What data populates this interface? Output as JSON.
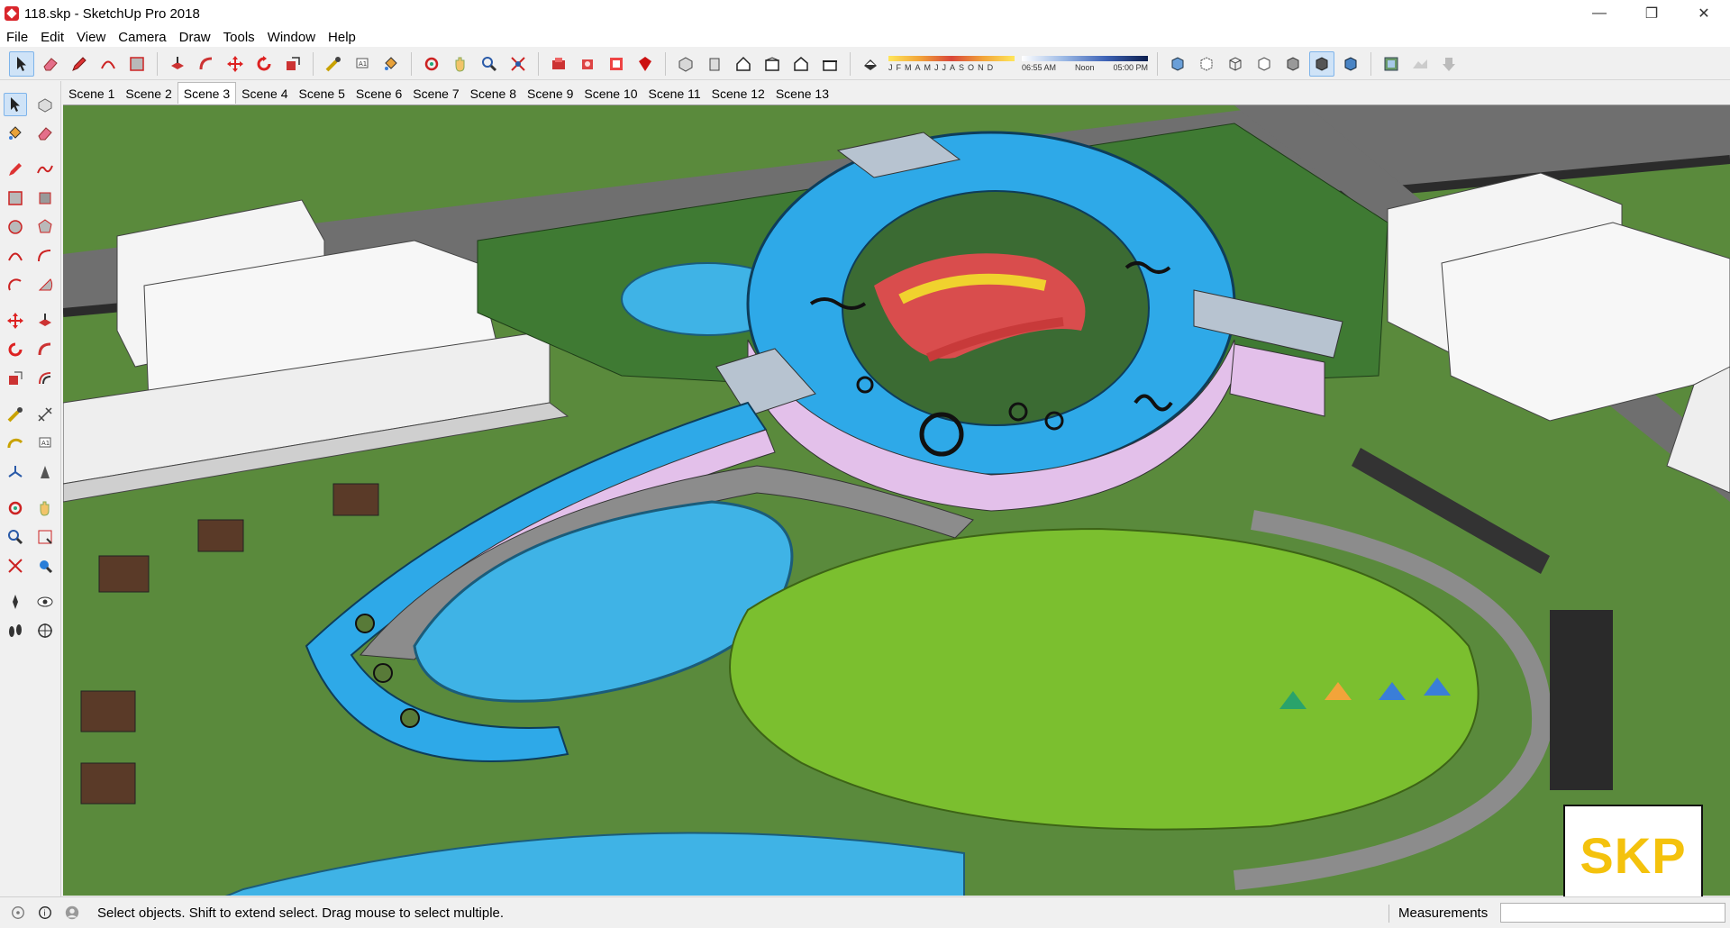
{
  "window": {
    "title": "118.skp - SketchUp Pro 2018",
    "controls": {
      "minimize": "—",
      "restore": "❐",
      "close": "✕"
    }
  },
  "menu": [
    "File",
    "Edit",
    "View",
    "Camera",
    "Draw",
    "Tools",
    "Window",
    "Help"
  ],
  "toolbar": {
    "icons": [
      "select-icon",
      "eraser-icon",
      "pencil-icon",
      "arc-icon",
      "rectangle-icon",
      "push-pull-icon",
      "rotate-icon",
      "move-icon",
      "follow-me-icon",
      "offset-icon",
      "tape-measure-icon",
      "text-icon",
      "paint-bucket-icon",
      "orbit-icon",
      "pan-icon",
      "zoom-icon",
      "zoom-extents-icon",
      "warehouse-icon",
      "extension-warehouse-icon",
      "layout-icon",
      "ruby-icon",
      "iso-view-icon",
      "top-view-icon",
      "front-view-icon",
      "right-view-icon",
      "back-view-icon",
      "left-view-icon",
      "shadow-toggle-icon"
    ],
    "shadow": {
      "months": [
        "J",
        "F",
        "M",
        "A",
        "M",
        "J",
        "J",
        "A",
        "S",
        "O",
        "N",
        "D"
      ],
      "time_start": "06:55 AM",
      "time_mid": "Noon",
      "time_end": "05:00 PM"
    }
  },
  "scenes": {
    "tabs": [
      "Scene 1",
      "Scene 2",
      "Scene 3",
      "Scene 4",
      "Scene 5",
      "Scene 6",
      "Scene 7",
      "Scene 8",
      "Scene 9",
      "Scene 10",
      "Scene 11",
      "Scene 12",
      "Scene 13"
    ],
    "active": "Scene 3"
  },
  "badge": {
    "text": "SKP",
    "color": "#f4c20d"
  },
  "status": {
    "message": "Select objects. Shift to extend select. Drag mouse to select multiple.",
    "measurements_label": "Measurements",
    "measurements_value": ""
  },
  "colors": {
    "ground": "#5a8a3c",
    "roof_blue": "#2ea9e8",
    "water": "#3fb3e6",
    "lawn": "#7bbf2f",
    "path": "#8c8c8c"
  }
}
